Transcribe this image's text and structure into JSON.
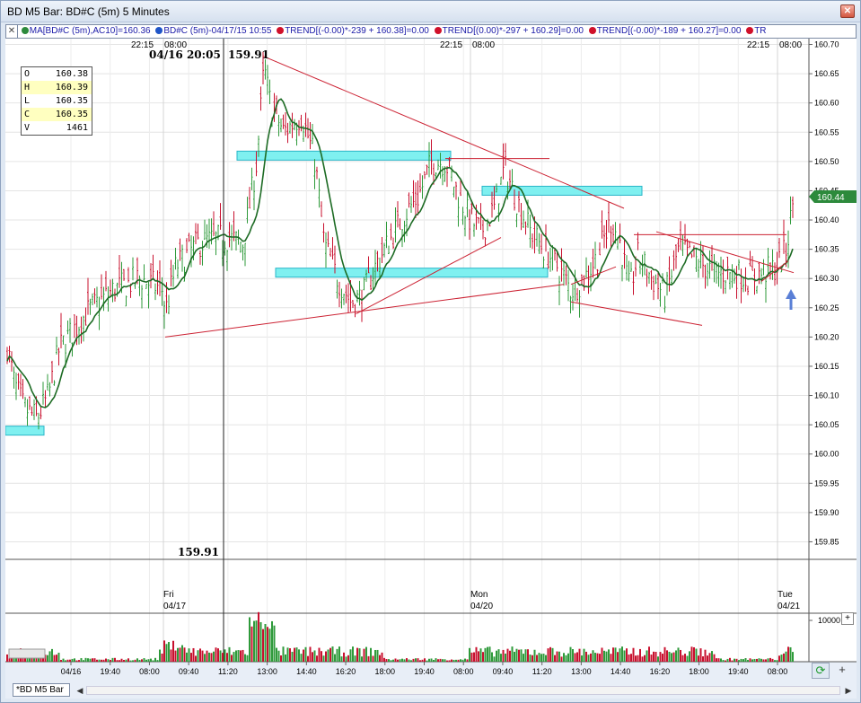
{
  "window": {
    "title": "BD M5 Bar: BD#C (5m) 5 Minutes",
    "close_glyph": "✕"
  },
  "legend": {
    "close_glyph": "✕",
    "items": [
      {
        "text": "MA[BD#C (5m),AC10]=160.36",
        "dot_color": "#2d8a3c"
      },
      {
        "text": "BD#C (5m)-04/17/15 10:55",
        "dot_color": "#1f55c8"
      },
      {
        "text": "TREND[(-0.00)*-239 + 160.38]=0.00",
        "dot_color": "#d0102a"
      },
      {
        "text": "TREND[(0.00)*-297 + 160.29]=0.00",
        "dot_color": "#d0102a"
      },
      {
        "text": "TREND[(-0.00)*-189 + 160.27]=0.00",
        "dot_color": "#d0102a"
      },
      {
        "text": "TR",
        "dot_color": "#d0102a"
      }
    ]
  },
  "ohlc": {
    "rows": [
      {
        "label": "O",
        "value": "160.38",
        "highlight": false
      },
      {
        "label": "H",
        "value": "160.39",
        "highlight": true
      },
      {
        "label": "L",
        "value": "160.35",
        "highlight": false
      },
      {
        "label": "C",
        "value": "160.35",
        "highlight": true
      },
      {
        "label": "V",
        "value": "1461",
        "highlight": false
      }
    ]
  },
  "cursor": {
    "label": "04/16 20:05",
    "price_label": "159.91",
    "bottom_price": "159.91"
  },
  "top_time_labels": [
    "22:15",
    "08:00",
    "22:15",
    "08:00",
    "22:15",
    "08:00"
  ],
  "price_axis": {
    "ticks": [
      "160.70",
      "160.65",
      "160.60",
      "160.55",
      "160.50",
      "160.45",
      "160.40",
      "160.35",
      "160.30",
      "160.25",
      "160.20",
      "160.15",
      "160.10",
      "160.05",
      "160.00",
      "159.95",
      "159.90",
      "159.85"
    ],
    "current_price": "160.44",
    "current_price_color": "#2d8a3c"
  },
  "day_labels": [
    {
      "day": "Fri",
      "date": "04/17"
    },
    {
      "day": "Mon",
      "date": "04/20"
    },
    {
      "day": "Tue",
      "date": "04/21"
    }
  ],
  "volume_axis": {
    "tick": "10000"
  },
  "time_axis": [
    "04/16",
    "19:40",
    "08:00",
    "09:40",
    "11:20",
    "13:00",
    "14:40",
    "16:20",
    "18:00",
    "19:40",
    "08:00",
    "09:40",
    "11:20",
    "13:00",
    "14:40",
    "16:20",
    "18:00",
    "19:40",
    "08:00"
  ],
  "buttons": {
    "zoom_in": "+",
    "reload": "⟳",
    "zoom_plus": "+"
  },
  "sheet_tab": "*BD M5 Bar",
  "colors": {
    "up_bar": "#2e9a3a",
    "down_bar": "#c8102e",
    "ma_line": "#1d6b24",
    "trend_line": "#cc2233",
    "zone_fill": "#7ff0f0",
    "zone_stroke": "#2ab6c8"
  },
  "chart_data": {
    "type": "line",
    "title": "BD M5 Bar: BD#C (5m) 5 Minutes",
    "xlabel": "",
    "ylabel": "",
    "ylim": [
      159.82,
      160.71
    ],
    "grid": true,
    "legend_position": "top",
    "x": [
      "04/16 19:40",
      "04/17 08:00",
      "04/17 11:20",
      "04/17 13:00",
      "04/17 14:40",
      "04/17 16:20",
      "04/17 18:00",
      "04/17 19:40",
      "04/20 08:00",
      "04/20 09:40",
      "04/20 11:20",
      "04/20 13:00",
      "04/20 14:40",
      "04/20 16:20",
      "04/20 18:00",
      "04/20 19:40",
      "04/21 08:00"
    ],
    "series": [
      {
        "name": "MA[BD#C (5m),AC10]",
        "values": [
          160.18,
          160.28,
          160.36,
          160.62,
          160.5,
          160.37,
          160.34,
          160.4,
          160.49,
          160.4,
          160.44,
          160.38,
          160.36,
          160.31,
          160.32,
          160.3,
          160.31
        ]
      },
      {
        "name": "BD#C (5m)",
        "values": [
          160.12,
          160.27,
          160.37,
          160.66,
          160.45,
          160.28,
          160.33,
          160.45,
          160.47,
          160.38,
          160.49,
          160.3,
          160.4,
          160.26,
          160.35,
          160.3,
          160.44
        ]
      }
    ],
    "trend_lines": [
      {
        "from": [
          "04/17 07:55",
          160.2
        ],
        "to": [
          "04/20 13:00",
          160.29
        ]
      },
      {
        "from": [
          "04/17 12:55",
          160.68
        ],
        "to": [
          "04/20 15:00",
          160.42
        ]
      },
      {
        "from": [
          "04/17 16:20",
          160.24
        ],
        "to": [
          "04/20 10:00",
          160.37
        ]
      },
      {
        "from": [
          "04/20 13:00",
          160.26
        ],
        "to": [
          "04/20 17:15",
          160.22
        ]
      },
      {
        "from": [
          "04/20 16:20",
          160.38
        ],
        "to": [
          "04/21 08:00",
          160.31
        ]
      }
    ],
    "zones": [
      {
        "from": "04/16 20:05",
        "to": "04/17 19:40",
        "y": 160.51
      },
      {
        "from": "04/17 16:20",
        "to": "04/20 11:20",
        "y": 160.31
      },
      {
        "from": "04/20 09:00",
        "to": "04/20 14:55",
        "y": 160.45
      },
      {
        "from": "04/16 19:40",
        "to": "04/16 19:55",
        "y": 160.04
      }
    ],
    "volume": {
      "ymax": 10000
    }
  }
}
